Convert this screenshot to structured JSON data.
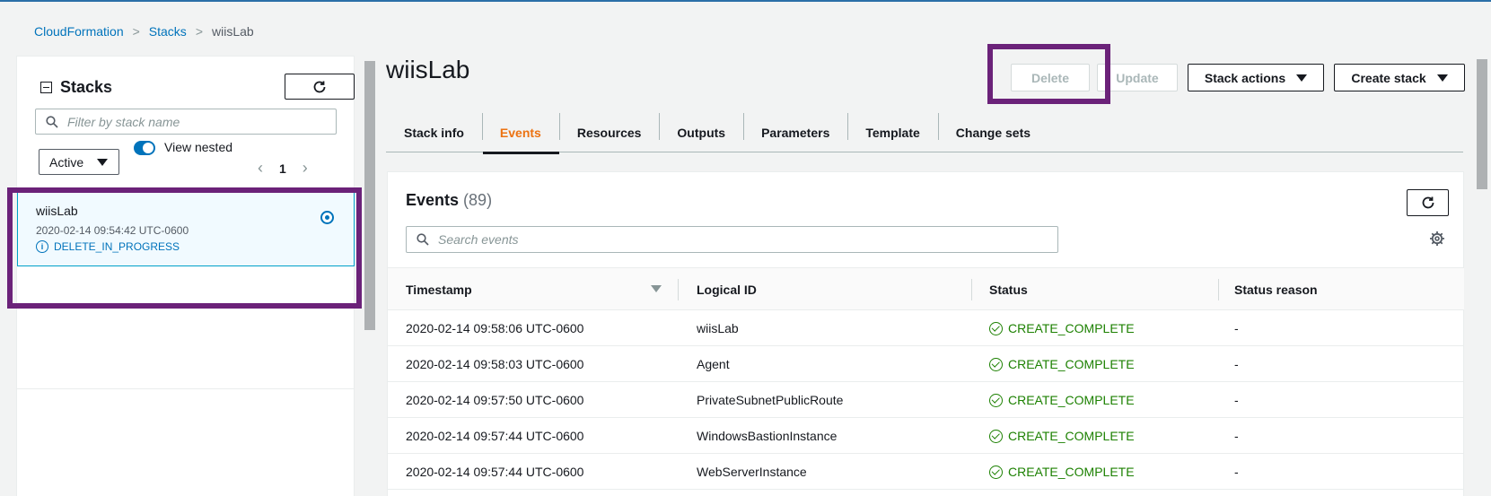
{
  "breadcrumb": {
    "items": [
      "CloudFormation",
      "Stacks"
    ],
    "current": "wiisLab"
  },
  "left_panel": {
    "title": "Stacks",
    "filter_placeholder": "Filter by stack name",
    "status_filter": "Active",
    "toggle_label": "View nested",
    "page": "1",
    "stack": {
      "name": "wiisLab",
      "created": "2020-02-14 09:54:42 UTC-0600",
      "status": "DELETE_IN_PROGRESS"
    }
  },
  "main": {
    "title": "wiisLab",
    "buttons": {
      "delete": "Delete",
      "update": "Update",
      "stack_actions": "Stack actions",
      "create_stack": "Create stack"
    },
    "tabs": [
      "Stack info",
      "Events",
      "Resources",
      "Outputs",
      "Parameters",
      "Template",
      "Change sets"
    ],
    "active_tab": "Events",
    "events": {
      "title": "Events",
      "count": "(89)",
      "search_placeholder": "Search events",
      "columns": [
        "Timestamp",
        "Logical ID",
        "Status",
        "Status reason"
      ],
      "rows": [
        {
          "timestamp": "2020-02-14 09:58:06 UTC-0600",
          "logical_id": "wiisLab",
          "status": "CREATE_COMPLETE",
          "reason": "-"
        },
        {
          "timestamp": "2020-02-14 09:58:03 UTC-0600",
          "logical_id": "Agent",
          "status": "CREATE_COMPLETE",
          "reason": "-"
        },
        {
          "timestamp": "2020-02-14 09:57:50 UTC-0600",
          "logical_id": "PrivateSubnetPublicRoute",
          "status": "CREATE_COMPLETE",
          "reason": "-"
        },
        {
          "timestamp": "2020-02-14 09:57:44 UTC-0600",
          "logical_id": "WindowsBastionInstance",
          "status": "CREATE_COMPLETE",
          "reason": "-"
        },
        {
          "timestamp": "2020-02-14 09:57:44 UTC-0600",
          "logical_id": "WebServerInstance",
          "status": "CREATE_COMPLETE",
          "reason": "-"
        }
      ]
    }
  },
  "colors": {
    "link": "#0073bb",
    "active_tab": "#ec7211",
    "success": "#1d8102",
    "highlight": "#6b2279"
  }
}
